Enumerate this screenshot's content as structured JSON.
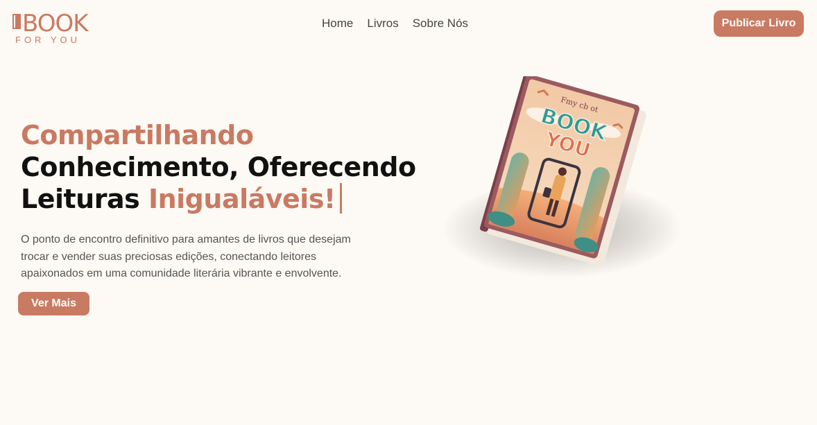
{
  "header": {
    "logo_word": "BOOK",
    "logo_sub": "FOR YOU",
    "nav": [
      {
        "label": "Home"
      },
      {
        "label": "Livros"
      },
      {
        "label": "Sobre Nós"
      }
    ],
    "publish_label": "Publicar Livro"
  },
  "hero": {
    "title_part1": "Compartilhando",
    "title_part2": "Conhecimento, Oferecendo",
    "title_part3": "Leituras",
    "title_part4": "Inigualáveis!",
    "description": "O ponto de encontro definitivo para amantes de livros que desejam trocar e vender suas preciosas edições, conectando leitores apaixonados em uma comunidade literária vibrante e envolvente.",
    "more_label": "Ver Mais"
  },
  "book": {
    "cover_small_text": "Fmy cb ot",
    "cover_title_1": "BOOK",
    "cover_title_2": "YOU"
  },
  "colors": {
    "accent": "#c97a62",
    "background": "#fdf9f4",
    "text": "#111111",
    "muted": "#555555"
  }
}
